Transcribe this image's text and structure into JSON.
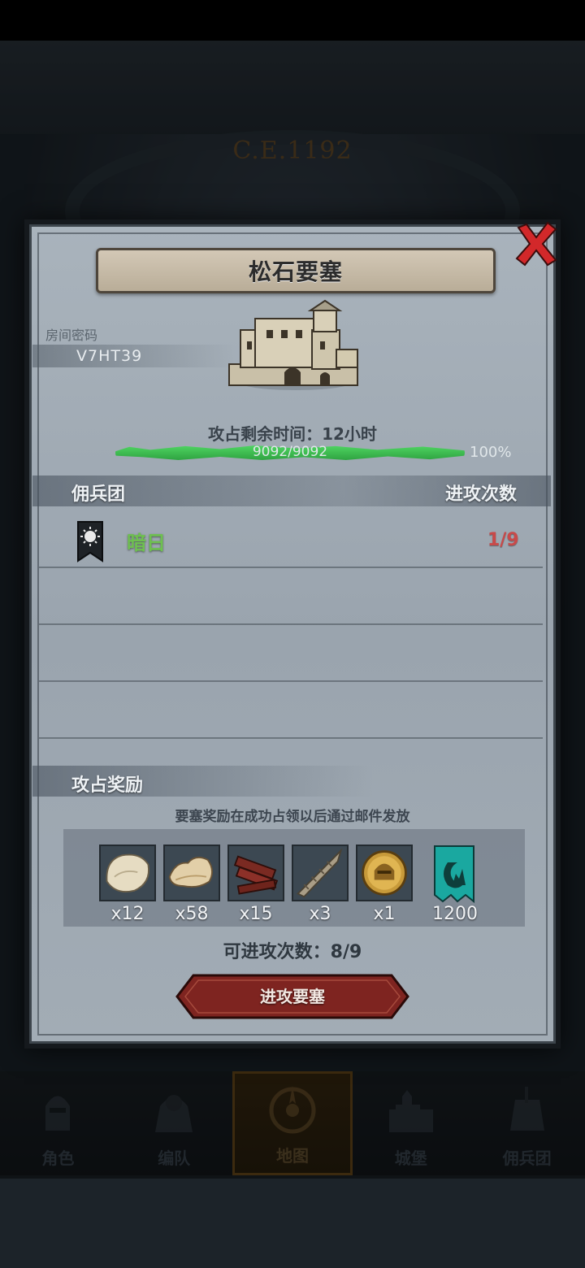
{
  "background": {
    "era_text": "C.E.1192"
  },
  "modal": {
    "title": "松石要塞",
    "room_label": "房间密码",
    "room_code": "V7HT39",
    "timer_label": "攻占剩余时间：",
    "timer_value": "12小时",
    "progress": {
      "text": "9092/9092",
      "percent_text": "100%",
      "fraction": 1.0,
      "color": "#3fbf52"
    },
    "mercenary_header": "佣兵团",
    "attack_count_header": "进攻次数",
    "mercenaries": [
      {
        "name": "暗日",
        "count": "1/9",
        "name_color": "#6ec050",
        "count_color": "#c84a4a"
      }
    ],
    "reward_header": "攻占奖励",
    "reward_note": "要塞奖励在成功占领以后通过邮件发放",
    "rewards": [
      {
        "icon": "fur-pelt-icon",
        "qty": "x12"
      },
      {
        "icon": "leather-hide-icon",
        "qty": "x58"
      },
      {
        "icon": "lumber-planks-icon",
        "qty": "x15"
      },
      {
        "icon": "spiral-horn-icon",
        "qty": "x3"
      },
      {
        "icon": "gold-helmet-coin-icon",
        "qty": "x1"
      },
      {
        "icon": "teal-guild-banner-icon",
        "qty": "1200"
      }
    ],
    "attempts_label": "可进攻次数：",
    "attempts_value": "8/9",
    "attack_button": "进攻要塞"
  },
  "nav": {
    "items": [
      {
        "label": "角色",
        "icon": "knight-helmet-icon",
        "active": false
      },
      {
        "label": "编队",
        "icon": "armored-knight-icon",
        "active": false
      },
      {
        "label": "地图",
        "icon": "compass-icon",
        "active": true
      },
      {
        "label": "城堡",
        "icon": "castle-icon",
        "active": false
      },
      {
        "label": "佣兵团",
        "icon": "mercenary-icon",
        "active": false
      }
    ]
  }
}
